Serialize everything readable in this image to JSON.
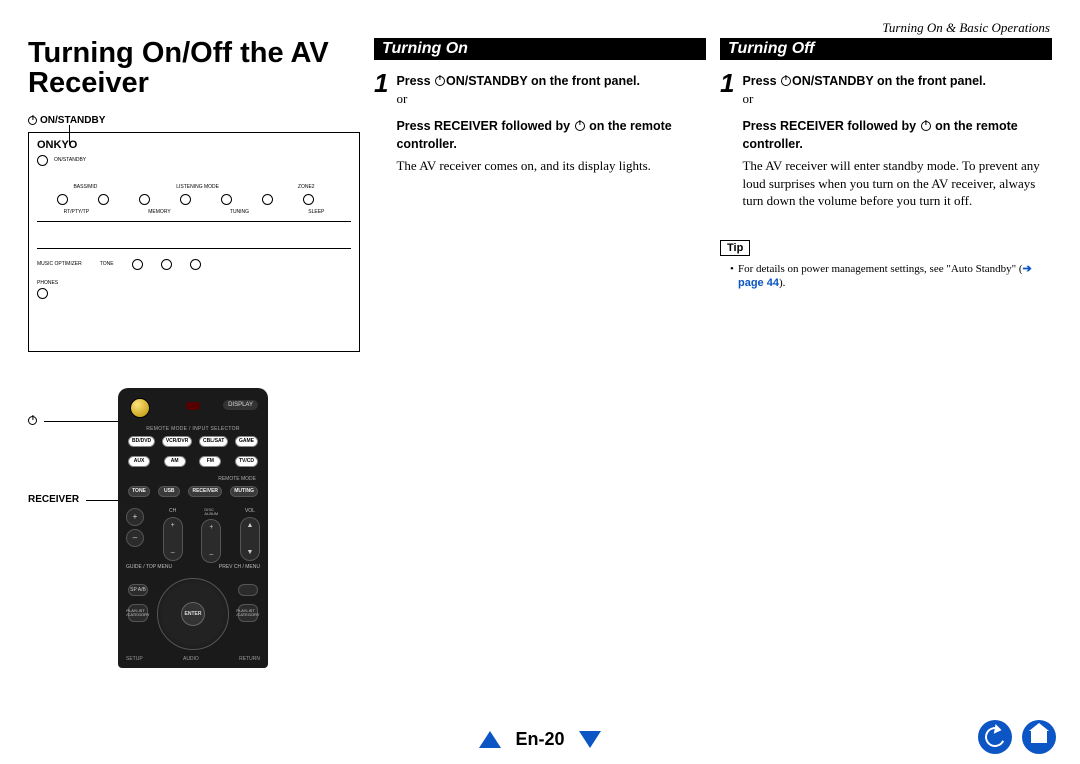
{
  "breadcrumb": "Turning On & Basic Operations",
  "page_title": "Turning On/Off the AV Receiver",
  "panel": {
    "btn_label": "ON/STANDBY",
    "brand": "ONKYO",
    "standby_label": "ON/STANDBY"
  },
  "remote_labels": {
    "power": "",
    "receiver": "RECEIVER"
  },
  "remote": {
    "display": "DISPLAY",
    "mode_label": "REMOTE MODE / INPUT SELECTOR",
    "row1": [
      "BD/DVD",
      "VCR/DVR",
      "CBL/SAT",
      "GAME"
    ],
    "row2": [
      "AUX",
      "AM",
      "FM",
      "TV/CD"
    ],
    "remote_mode": "REMOTE MODE",
    "row3": [
      "TONE",
      "USB",
      "RECEIVER",
      "MUTING"
    ],
    "ch": "CH",
    "disc_album": "DISC ALBUM",
    "vol": "VOL",
    "menu_left": "GUIDE / TOP MENU",
    "menu_right": "PREV CH / MENU",
    "sp_ab": "SP A/B",
    "playlist_l": "PLAYLIST /CATEGORY",
    "playlist_r": "PLAYLIST /CATEGORY",
    "enter": "ENTER",
    "setup": "SETUP",
    "audio": "AUDIO",
    "return": "RETURN"
  },
  "turning_on": {
    "header": "Turning On",
    "step_num": "1",
    "line1a": "Press ",
    "line1b": "ON/STANDBY on the front panel.",
    "or": "or",
    "line2": "Press RECEIVER followed by ",
    "line2b": " on the remote controller.",
    "desc": "The AV receiver comes on, and its display lights."
  },
  "turning_off": {
    "header": "Turning Off",
    "step_num": "1",
    "line1a": "Press ",
    "line1b": "ON/STANDBY on the front panel.",
    "or": "or",
    "line2": "Press RECEIVER followed by ",
    "line2b": " on the remote controller.",
    "desc": "The AV receiver will enter standby mode. To prevent any loud surprises when you turn on the AV receiver, always turn down the volume before you turn it off."
  },
  "tip": {
    "label": "Tip",
    "text": "For details on power management settings, see \"Auto Standby\" (",
    "arrow": "➔",
    "page_ref": "page 44",
    "close": ")."
  },
  "footer": {
    "page": "En-20"
  }
}
